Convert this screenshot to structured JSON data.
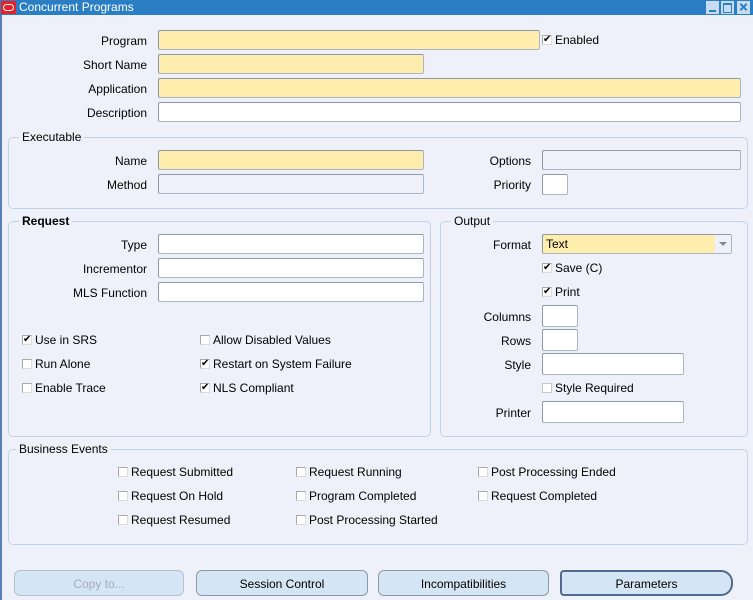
{
  "window": {
    "title": "Concurrent Programs",
    "controls": [
      "minimize-icon",
      "maximize-icon",
      "close-icon"
    ]
  },
  "header": {
    "program": {
      "label": "Program",
      "value": "",
      "required": true
    },
    "short_name": {
      "label": "Short Name",
      "value": "",
      "required": true
    },
    "application": {
      "label": "Application",
      "value": "",
      "required": true
    },
    "description": {
      "label": "Description",
      "value": ""
    },
    "enabled": {
      "label": "Enabled",
      "mnemonic": "n",
      "checked": true
    }
  },
  "executable": {
    "title": "Executable",
    "name": {
      "label": "Name",
      "value": "",
      "required": true
    },
    "method": {
      "label": "Method",
      "value": "",
      "readonly": true
    },
    "options": {
      "label": "Options",
      "value": "",
      "readonly": true
    },
    "priority": {
      "label": "Priority",
      "value": ""
    }
  },
  "request": {
    "title": "Request",
    "type": {
      "label": "Type",
      "value": ""
    },
    "incrementor": {
      "label": "Incrementor",
      "value": ""
    },
    "mls_function": {
      "label": "MLS Function",
      "value": ""
    },
    "checkboxes": [
      {
        "label": "Use in SRS",
        "mnemonic": "U",
        "checked": true
      },
      {
        "label": "Run Alone",
        "mnemonic": "A",
        "checked": false
      },
      {
        "label": "Enable Trace",
        "mnemonic": "b",
        "checked": false
      },
      {
        "label": "Allow Disabled Values",
        "mnemonic": "D",
        "checked": false
      },
      {
        "label": "Restart on System Failure",
        "mnemonic": "R",
        "checked": true
      },
      {
        "label": "NLS Compliant",
        "mnemonic": "S",
        "checked": true
      }
    ]
  },
  "output": {
    "title": "Output",
    "format": {
      "label": "Format",
      "value": "Text"
    },
    "save": {
      "label": "Save (C)",
      "mnemonic": "C",
      "checked": true
    },
    "print": {
      "label": "Print",
      "mnemonic": "P",
      "checked": true
    },
    "columns": {
      "label": "Columns",
      "value": ""
    },
    "rows": {
      "label": "Rows",
      "value": ""
    },
    "style": {
      "label": "Style",
      "value": ""
    },
    "style_required": {
      "label": "Style Required",
      "checked": false,
      "disabled": true
    },
    "printer": {
      "label": "Printer",
      "value": ""
    }
  },
  "business_events": {
    "title": "Business Events",
    "checkboxes": [
      {
        "label": "Request Submitted",
        "checked": false
      },
      {
        "label": "Request On Hold",
        "checked": false
      },
      {
        "label": "Request Resumed",
        "checked": false
      },
      {
        "label": "Request Running",
        "checked": false
      },
      {
        "label": "Program Completed",
        "checked": false
      },
      {
        "label": "Post Processing Started",
        "checked": false
      },
      {
        "label": "Post Processing Ended",
        "checked": false
      },
      {
        "label": "Request Completed",
        "checked": false
      }
    ]
  },
  "buttons": {
    "copy_to": {
      "label": "Copy to...",
      "disabled": true
    },
    "session_control": {
      "label": "Session Control"
    },
    "incompatibilities": {
      "label": "Incompatibilities"
    },
    "parameters": {
      "label": "Parameters",
      "default": true
    }
  }
}
